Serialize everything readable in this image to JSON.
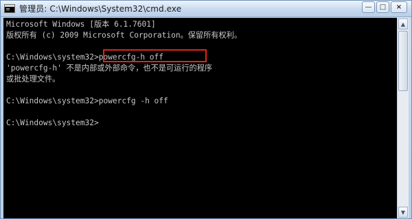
{
  "window": {
    "title": "管理员: C:\\Windows\\System32\\cmd.exe",
    "minimize_icon": "minimize-icon",
    "maximize_icon": "maximize-icon",
    "close_icon": "close-icon",
    "highlight_color": "#e1251b"
  },
  "console": {
    "background": "#000000",
    "text_color": "#c8c8c8",
    "lines": [
      "Microsoft Windows [版本 6.1.7601]",
      "版权所有 (c) 2009 Microsoft Corporation。保留所有权利。",
      "",
      "C:\\Windows\\system32>powercfg-h off",
      "'powercfg-h' 不是内部或外部命令，也不是可运行的程序",
      "或批处理文件。",
      "",
      "C:\\Windows\\system32>powercfg -h off",
      "",
      "C:\\Windows\\system32>"
    ]
  }
}
